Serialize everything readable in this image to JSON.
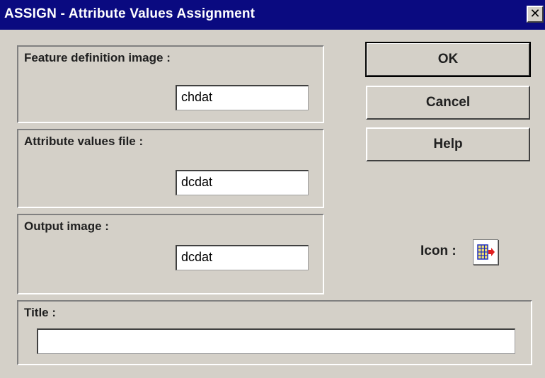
{
  "window": {
    "title": "ASSIGN - Attribute Values Assignment",
    "close_glyph": "✕"
  },
  "groups": {
    "feature_definition": {
      "label": "Feature definition image :",
      "value": "chdat"
    },
    "attribute_values": {
      "label": "Attribute values file :",
      "value": "dcdat"
    },
    "output_image": {
      "label": "Output image :",
      "value": "dcdat"
    },
    "title": {
      "label": "Title :",
      "value": ""
    }
  },
  "buttons": {
    "ok": "OK",
    "cancel": "Cancel",
    "help": "Help"
  },
  "icon_picker": {
    "label": "Icon :",
    "icon": "table-arrow-icon",
    "accent_colors": {
      "grid": "#2030c0",
      "arrow": "#e02020",
      "fill": "#f0e070"
    }
  }
}
